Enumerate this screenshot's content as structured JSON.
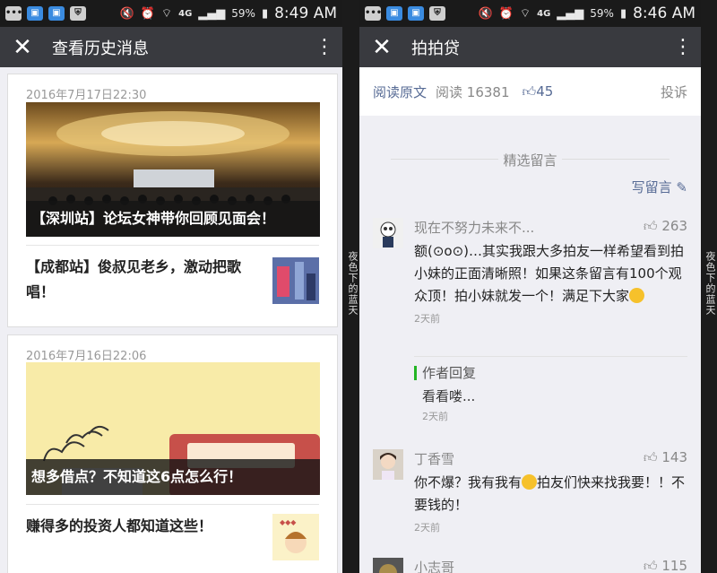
{
  "left": {
    "status": {
      "battery": "59%",
      "time": "8:49 AM",
      "network": "4G"
    },
    "title": "查看历史消息",
    "cards": [
      {
        "date": "2016年7月17日22:30",
        "hero_caption": "【深圳站】论坛女神带你回顾见面会！",
        "sub_title": "【成都站】俊叔见老乡，激动把歌唱！"
      },
      {
        "date": "2016年7月16日22:06",
        "hero_caption": "想多借点？不知道这6点怎么行！",
        "sub_title": "赚得多的投资人都知道这些！"
      }
    ]
  },
  "middle_strip_text": "夜色下的蓝天",
  "right_strip_text": "夜色下的蓝天",
  "right": {
    "status": {
      "battery": "59%",
      "time": "8:46 AM",
      "network": "4G"
    },
    "title": "拍拍贷",
    "meta": {
      "read_original": "阅读原文",
      "reads": "阅读 16381",
      "likes": "45",
      "report": "投诉"
    },
    "section_title": "精选留言",
    "write_comment": "写留言",
    "comments": [
      {
        "name": "现在不努力未来不...",
        "likes": "263",
        "text": "额(⊙o⊙)…其实我跟大多拍友一样希望看到拍小妹的正面清晰照！如果这条留言有100个观众顶！拍小妹就发一个！满足下大家",
        "time": "2天前",
        "reply": {
          "label": "作者回复",
          "text": "看看喽...",
          "time": "2天前"
        }
      },
      {
        "name": "丁香雪",
        "likes": "143",
        "text": "你不爆？我有我有",
        "text2": "拍友们快来找我要！！不要钱的！",
        "time": "2天前"
      },
      {
        "name": "小志哥",
        "likes": "115"
      }
    ]
  },
  "colors": {
    "titlebar": "#393a3f",
    "link": "#576b95",
    "reply_accent": "#23b524"
  }
}
